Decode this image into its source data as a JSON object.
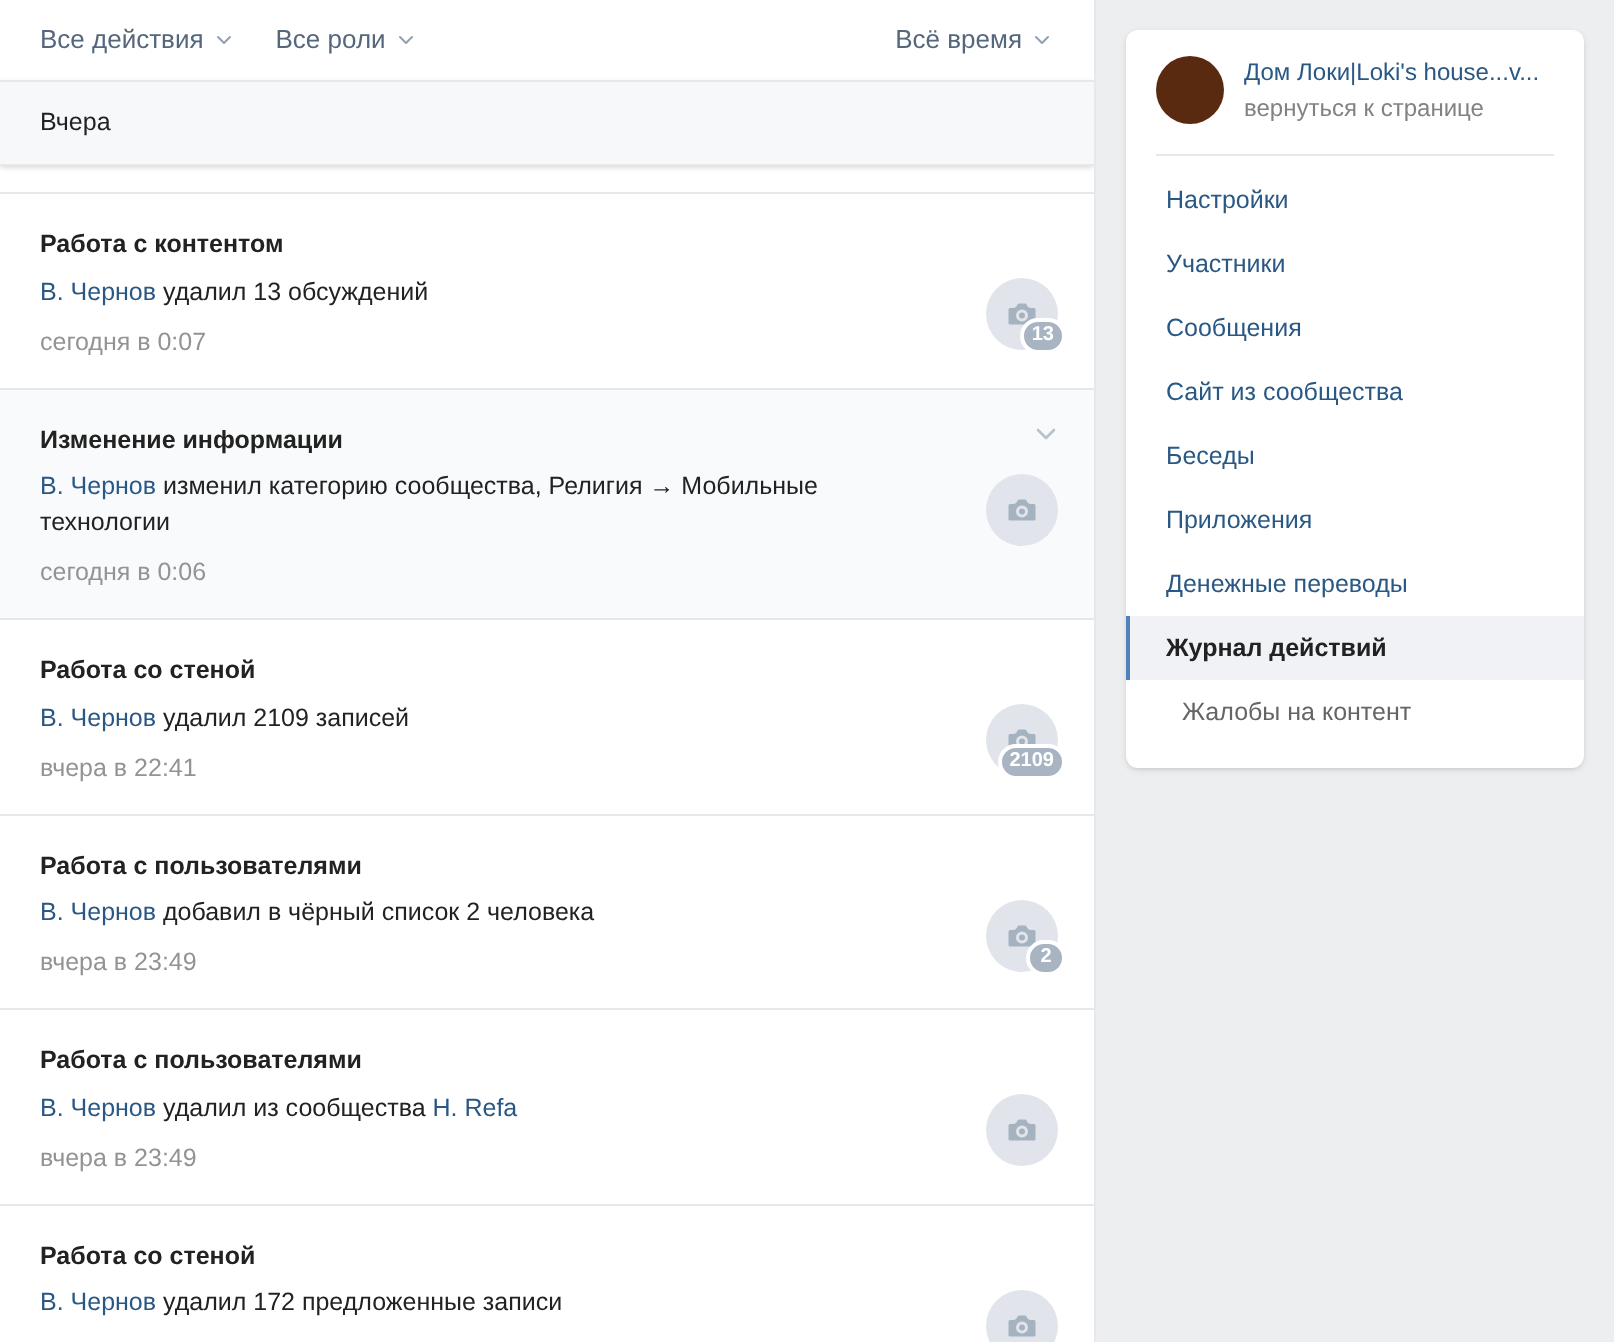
{
  "filters": {
    "left": [
      {
        "label": "Все действия"
      },
      {
        "label": "Все роли"
      }
    ],
    "right": {
      "label": "Всё время"
    }
  },
  "day_header": "Вчера",
  "entries": [
    {
      "title": "Работа с контентом",
      "segments": [
        {
          "text": "В. Чернов",
          "link": true
        },
        {
          "text": " удалил 13 обсуждений",
          "link": false
        }
      ],
      "time": "сегодня в 0:07",
      "badge": "13",
      "highlighted": false
    },
    {
      "title": "Изменение информации",
      "segments": [
        {
          "text": "В. Чернов",
          "link": true
        },
        {
          "text": " изменил категорию сообщества, Религия → Мобильные технологии",
          "link": false
        }
      ],
      "time": "сегодня в 0:06",
      "highlighted": true
    },
    {
      "title": "Работа со стеной",
      "segments": [
        {
          "text": "В. Чернов",
          "link": true
        },
        {
          "text": " удалил 2109 записей",
          "link": false
        }
      ],
      "time": "вчера в 22:41",
      "badge": "2109",
      "highlighted": false
    },
    {
      "title": "Работа с пользователями",
      "segments": [
        {
          "text": "В. Чернов",
          "link": true
        },
        {
          "text": " добавил в чёрный список 2 человека",
          "link": false
        }
      ],
      "time": "вчера в 23:49",
      "badge": "2",
      "highlighted": false
    },
    {
      "title": "Работа с пользователями",
      "segments": [
        {
          "text": "В. Чернов",
          "link": true
        },
        {
          "text": " удалил из сообщества ",
          "link": false
        },
        {
          "text": "Н. Refa",
          "link": true
        }
      ],
      "time": "вчера в 23:49",
      "highlighted": false
    },
    {
      "title": "Работа со стеной",
      "segments": [
        {
          "text": "В. Чернов",
          "link": true
        },
        {
          "text": " удалил 172 предложенные записи",
          "link": false
        }
      ],
      "highlighted": false
    }
  ],
  "sidebar": {
    "community_name": "Дом Локи|Loki's house...v...",
    "back_link": "вернуться к странице",
    "items": [
      {
        "label": "Настройки",
        "selected": false,
        "sub": false
      },
      {
        "label": "Участники",
        "selected": false,
        "sub": false
      },
      {
        "label": "Сообщения",
        "selected": false,
        "sub": false
      },
      {
        "label": "Сайт из сообщества",
        "selected": false,
        "sub": false
      },
      {
        "label": "Беседы",
        "selected": false,
        "sub": false
      },
      {
        "label": "Приложения",
        "selected": false,
        "sub": false
      },
      {
        "label": "Денежные переводы",
        "selected": false,
        "sub": false
      },
      {
        "label": "Журнал действий",
        "selected": true,
        "sub": false
      },
      {
        "label": "Жалобы на контент",
        "selected": false,
        "sub": true
      }
    ]
  }
}
